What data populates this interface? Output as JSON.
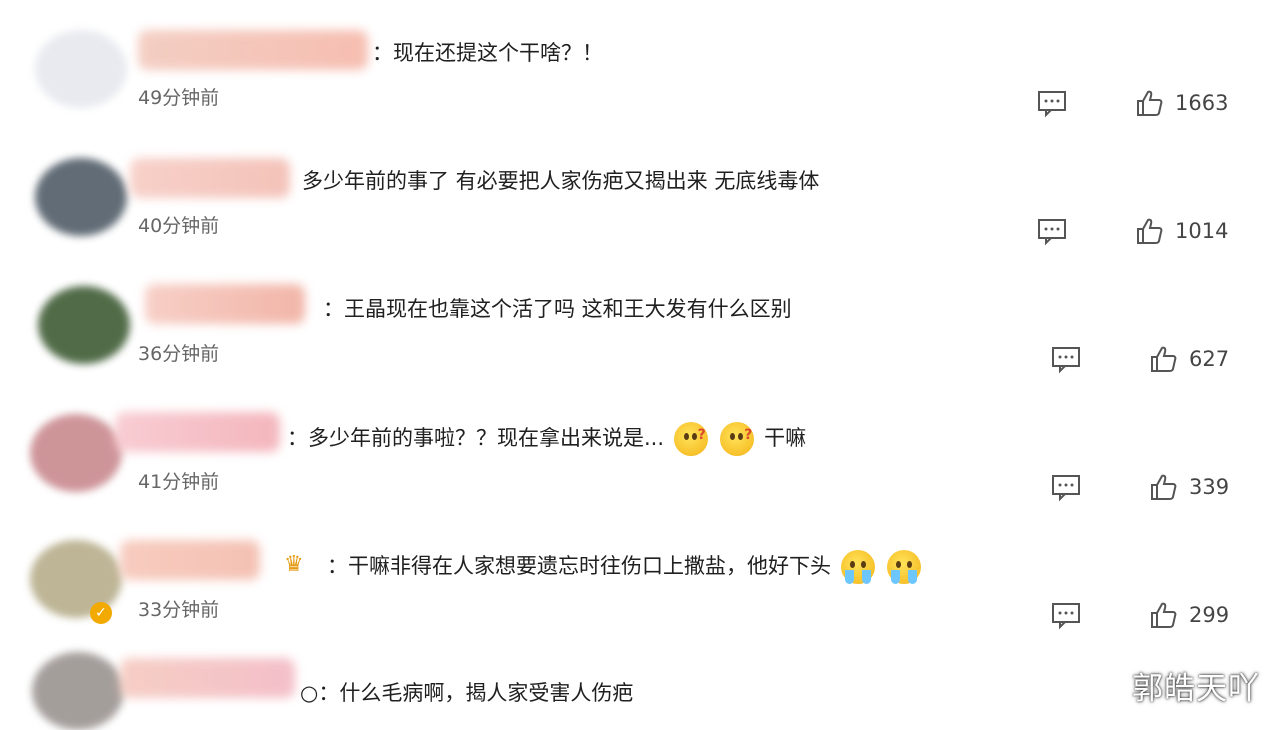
{
  "comments": [
    {
      "text": "：现在还提这个干啥？！",
      "time": "49分钟前",
      "likes": "1663",
      "avatar_color": "#e6e8ee",
      "name_colors": [
        "#f2c6b9",
        "#f5b3a4"
      ]
    },
    {
      "text": "多少年前的事了 有必要把人家伤疤又揭出来 无底线毒体",
      "time": "40分钟前",
      "likes": "1014",
      "avatar_color": "#515d68",
      "name_colors": [
        "#f6c9c0",
        "#f2b8ad"
      ]
    },
    {
      "text": "：王晶现在也靠这个活了吗 这和王大发有什么区别",
      "time": "36分钟前",
      "likes": "627",
      "avatar_color": "#3f5c35",
      "name_colors": [
        "#f6c7bd",
        "#f0a99a"
      ]
    },
    {
      "text_before": "：多少年前的事啦？？现在拿出来说是...",
      "emoji_1": "question-face",
      "emoji_2": "question-face",
      "text_after": "干嘛",
      "time": "41分钟前",
      "likes": "339",
      "avatar_color": "#c98a8f",
      "name_colors": [
        "#f7c4cb",
        "#f2aab2"
      ]
    },
    {
      "text_before": "：干嘛非得在人家想要遗忘时往伤口上撒盐，他好下头",
      "emoji_1": "crying-face",
      "emoji_2": "crying-face",
      "time": "33分钟前",
      "likes": "299",
      "avatar_color": "#b6ad8a",
      "name_colors": [
        "#f6c3b4",
        "#f3b7a7"
      ],
      "badge": "✓",
      "crown": "♛"
    },
    {
      "text": "○：什么毛病啊，揭人家受害人伤疤",
      "avatar_color": "#9b9491",
      "name_colors": [
        "#f5c6bb",
        "#f2b4c0"
      ]
    }
  ],
  "watermark": "郭皓天吖",
  "icons": {
    "reply": "comment-reply-icon",
    "like": "thumbs-up-icon"
  }
}
